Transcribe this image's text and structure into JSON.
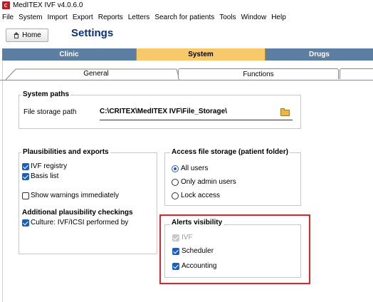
{
  "window": {
    "title": "MedITEX IVF v4.0.6.0"
  },
  "menu": [
    "File",
    "System",
    "Import",
    "Export",
    "Reports",
    "Letters",
    "Search for patients",
    "Tools",
    "Window",
    "Help"
  ],
  "toolbar": {
    "home_label": "Home",
    "page_title": "Settings"
  },
  "main_tabs": [
    {
      "label": "Clinic",
      "active": false
    },
    {
      "label": "System",
      "active": true
    },
    {
      "label": "Drugs",
      "active": false
    }
  ],
  "sub_tabs": [
    {
      "label": "General",
      "active": true
    },
    {
      "label": "Functions",
      "active": false
    },
    {
      "label": "",
      "active": false
    }
  ],
  "system_paths": {
    "title": "System paths",
    "file_storage_label": "File storage path",
    "file_storage_value": "C:\\CRITEX\\MedITEX IVF\\File_Storage\\"
  },
  "plausibilities": {
    "title": "Plausibilities and exports",
    "items": [
      {
        "label": "IVF registry",
        "checked": true
      },
      {
        "label": "Basis list",
        "checked": true
      },
      {
        "label": "Show warnings immediately",
        "checked": false
      }
    ],
    "additional_title": "Additional plausibility checkings",
    "additional_items": [
      {
        "label": "Culture: IVF/ICSI performed by",
        "checked": true
      }
    ]
  },
  "access": {
    "title": "Access file storage (patient folder)",
    "options": [
      {
        "label": "All users",
        "selected": true
      },
      {
        "label": "Only admin users",
        "selected": false
      },
      {
        "label": "Lock access",
        "selected": false
      }
    ]
  },
  "alerts": {
    "title": "Alerts visibility",
    "items": [
      {
        "label": "IVF",
        "checked": true,
        "disabled": true
      },
      {
        "label": "Scheduler",
        "checked": true,
        "disabled": false
      },
      {
        "label": "Accounting",
        "checked": true,
        "disabled": false
      }
    ]
  },
  "colors": {
    "accent": "#1d5fbf",
    "tab_bar": "#5c7ea3",
    "active_tab": "#f7c96a",
    "highlight": "#e0232c",
    "title_blue": "#0c2f7a"
  }
}
